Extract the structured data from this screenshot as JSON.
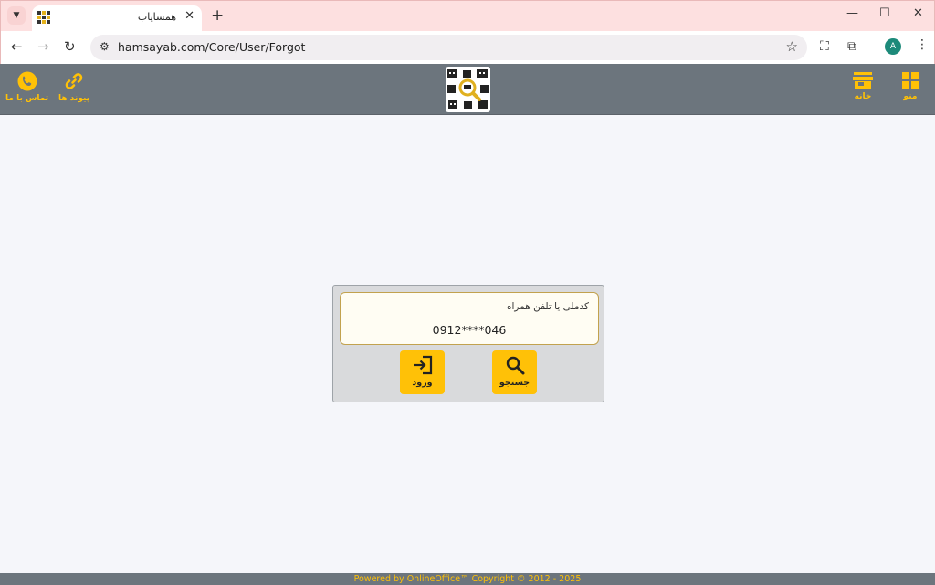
{
  "browser": {
    "tab_title": "همسایاب",
    "url": "hamsayab.com/Core/User/Forgot",
    "profile_initial": "A"
  },
  "header": {
    "contact_label": "تماس با ما",
    "links_label": "پیوند ها",
    "home_label": "خانه",
    "menu_label": "منو",
    "accent_color": "#ffc107",
    "bar_color": "#6c757d"
  },
  "form": {
    "field_label": "کدملی یا تلفن همراه",
    "field_value": "0912****046",
    "search_label": "جستجو",
    "login_label": "ورود"
  },
  "footer": {
    "text": "Powered by OnlineOffice™ Copyright © 2012 - 2025"
  }
}
